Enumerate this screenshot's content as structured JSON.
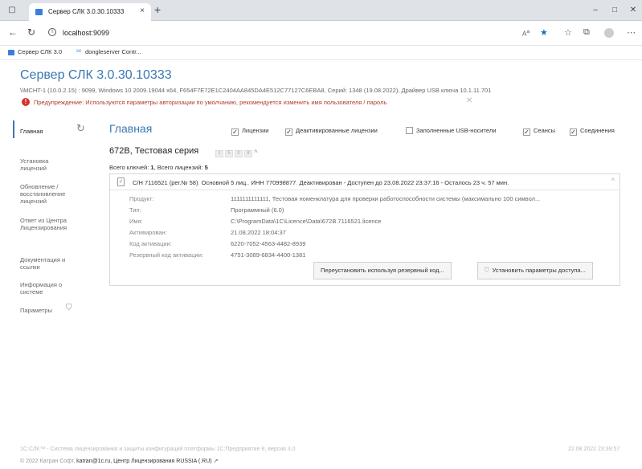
{
  "browser": {
    "tab_title": "Сервер СЛК 3.0.30.10333",
    "tab_close": "×",
    "new_tab": "+",
    "url": "localhost:9099",
    "bookmarks": [
      "Сервер СЛК 3.0",
      "dongleserver Contr..."
    ],
    "bookmark_prefix": "sx"
  },
  "header": {
    "title": "Сервер СЛК 3.0.30.10333",
    "sysinfo": "\\\\MCHT-1 (10.0.2.15) : 9099,  Windows 10 2009.19044 x64,  F654F7E72E1C2404AA845DA4E512C77127C6EBA8,  Серий: 1348 (19.08.2022),  Драйвер USB ключа 10.1.11.701",
    "warning": "Предупреждение: Используются параметры авторизации по умолчанию, рекомендуется изменить имя пользователя / пароль"
  },
  "sidebar": {
    "items": [
      "Главная",
      "Установка лицензий",
      "Обновление / восстановление лицензий",
      "Ответ из Центра Лицензирования",
      "Документация и ссылки",
      "Информация о системе",
      "Параметры"
    ]
  },
  "main": {
    "title": "Главная",
    "filters": [
      {
        "label": "Лицензии",
        "checked": true
      },
      {
        "label": "Деактивированные лицензии",
        "checked": true
      },
      {
        "label": "Заполненные USB-носители",
        "checked": false
      },
      {
        "label": "Сеансы",
        "checked": true
      },
      {
        "label": "Соединения",
        "checked": true
      }
    ],
    "check_mark": "✓",
    "series_title": "672B, Тестовая серия",
    "pages": [
      "1",
      "5",
      "0",
      "8"
    ],
    "totals_prefix": "Всего ключей: ",
    "keys_count": "1",
    "totals_mid": ",  Всего лицензий: ",
    "licenses_count": "5",
    "card": {
      "serial": "С/Н 7116521 (рег.№ 58)",
      "type": "Основной 5 лиц.",
      "inn": "ИНН 770998877",
      "status": "Деактивирован - Доступен до 23.08.2022 23:37:16 - Осталось 23 ч. 57 мин.",
      "rows": [
        {
          "key": "Продукт:",
          "value": "1111111111111, Тестовая номенклатура для проверки работоспособности системы (максимально 100 символ..."
        },
        {
          "key": "Тип:",
          "value": "Программный (6.0)"
        },
        {
          "key": "Имя:",
          "value": "C:\\ProgramData\\1C\\Licence\\Data\\672B.7116521.licence"
        },
        {
          "key": "Активирован:",
          "value": "21.08.2022 18:04:37"
        },
        {
          "key": "Код активации:",
          "value": "6220-7052-4563-4482-8939"
        },
        {
          "key": "Резервный код активации:",
          "value": "4751-3089-6834-4400-1381"
        }
      ],
      "btn_reinstall": "Переустановить используя резервный код...",
      "btn_access": "Установить параметры доступа..."
    }
  },
  "footer": {
    "line1": "1С:СЛК™ - Система лицензирования и защиты конфигураций платформы 1С:Предприятие 8, версия 3.0",
    "date": "22.08.2022 23:39:57",
    "copyright": "© 2022 Катран Софт, ",
    "email": "katran@1c.ru",
    "center": ", Центр Лицензирования RUSSIA (.RU)"
  }
}
